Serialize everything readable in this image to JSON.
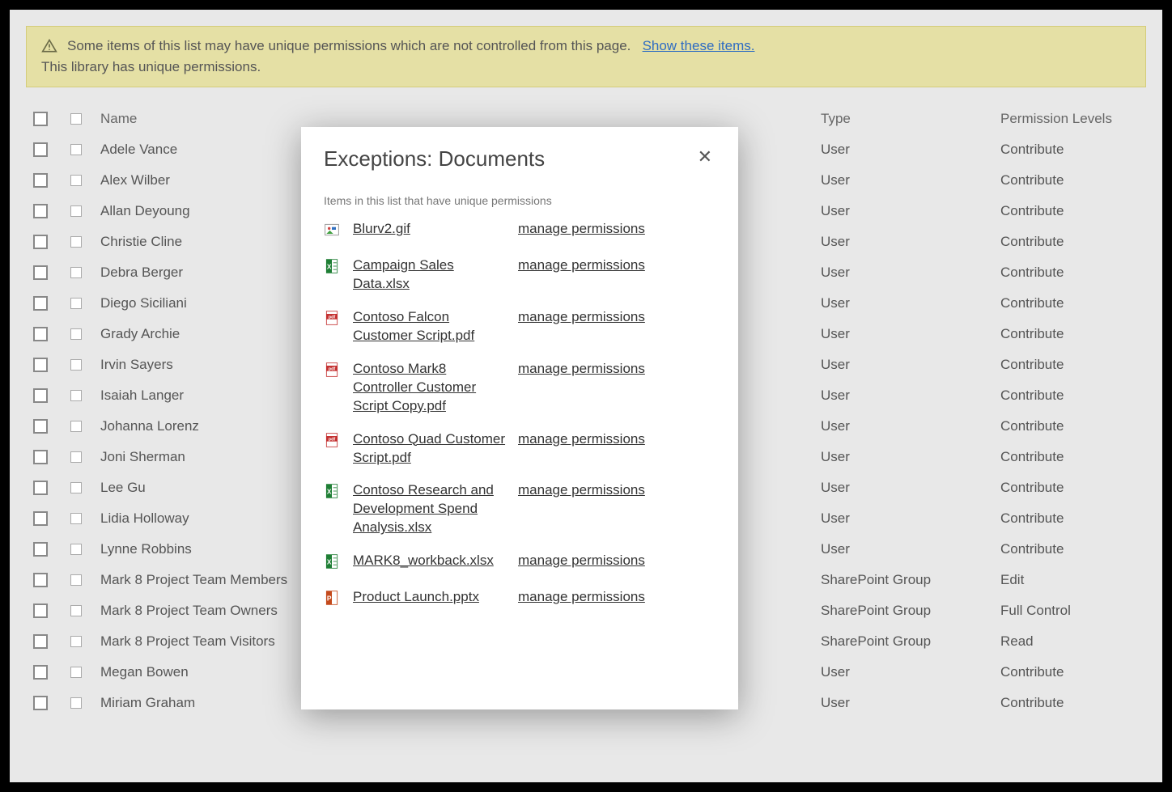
{
  "notice": {
    "line1": "Some items of this list may have unique permissions which are not controlled from this page.",
    "show_link": "Show these items.",
    "line2": "This library has unique permissions."
  },
  "table": {
    "headers": {
      "name": "Name",
      "type": "Type",
      "perm": "Permission Levels"
    },
    "rows": [
      {
        "name": "Adele Vance",
        "type": "User",
        "perm": "Contribute"
      },
      {
        "name": "Alex Wilber",
        "type": "User",
        "perm": "Contribute"
      },
      {
        "name": "Allan Deyoung",
        "type": "User",
        "perm": "Contribute"
      },
      {
        "name": "Christie Cline",
        "type": "User",
        "perm": "Contribute"
      },
      {
        "name": "Debra Berger",
        "type": "User",
        "perm": "Contribute"
      },
      {
        "name": "Diego Siciliani",
        "type": "User",
        "perm": "Contribute"
      },
      {
        "name": "Grady Archie",
        "type": "User",
        "perm": "Contribute"
      },
      {
        "name": "Irvin Sayers",
        "type": "User",
        "perm": "Contribute"
      },
      {
        "name": "Isaiah Langer",
        "type": "User",
        "perm": "Contribute"
      },
      {
        "name": "Johanna Lorenz",
        "type": "User",
        "perm": "Contribute"
      },
      {
        "name": "Joni Sherman",
        "type": "User",
        "perm": "Contribute"
      },
      {
        "name": "Lee Gu",
        "type": "User",
        "perm": "Contribute"
      },
      {
        "name": "Lidia Holloway",
        "type": "User",
        "perm": "Contribute"
      },
      {
        "name": "Lynne Robbins",
        "type": "User",
        "perm": "Contribute"
      },
      {
        "name": "Mark 8 Project Team Members",
        "type": "SharePoint Group",
        "perm": "Edit"
      },
      {
        "name": "Mark 8 Project Team Owners",
        "type": "SharePoint Group",
        "perm": "Full Control"
      },
      {
        "name": "Mark 8 Project Team Visitors",
        "type": "SharePoint Group",
        "perm": "Read"
      },
      {
        "name": "Megan Bowen",
        "type": "User",
        "perm": "Contribute"
      },
      {
        "name": "Miriam Graham",
        "type": "User",
        "perm": "Contribute"
      }
    ]
  },
  "modal": {
    "title": "Exceptions: Documents",
    "subtitle": "Items in this list that have unique permissions",
    "manage_label": "manage permissions",
    "items": [
      {
        "name": "Blurv2.gif",
        "type": "image"
      },
      {
        "name": "Campaign Sales Data.xlsx",
        "type": "xlsx"
      },
      {
        "name": "Contoso Falcon Customer Script.pdf",
        "type": "pdf"
      },
      {
        "name": "Contoso Mark8 Controller Customer Script Copy.pdf",
        "type": "pdf"
      },
      {
        "name": "Contoso Quad Customer Script.pdf",
        "type": "pdf"
      },
      {
        "name": "Contoso Research and Development Spend Analysis.xlsx",
        "type": "xlsx"
      },
      {
        "name": "MARK8_workback.xlsx",
        "type": "xlsx"
      },
      {
        "name": "Product Launch.pptx",
        "type": "pptx"
      }
    ]
  }
}
